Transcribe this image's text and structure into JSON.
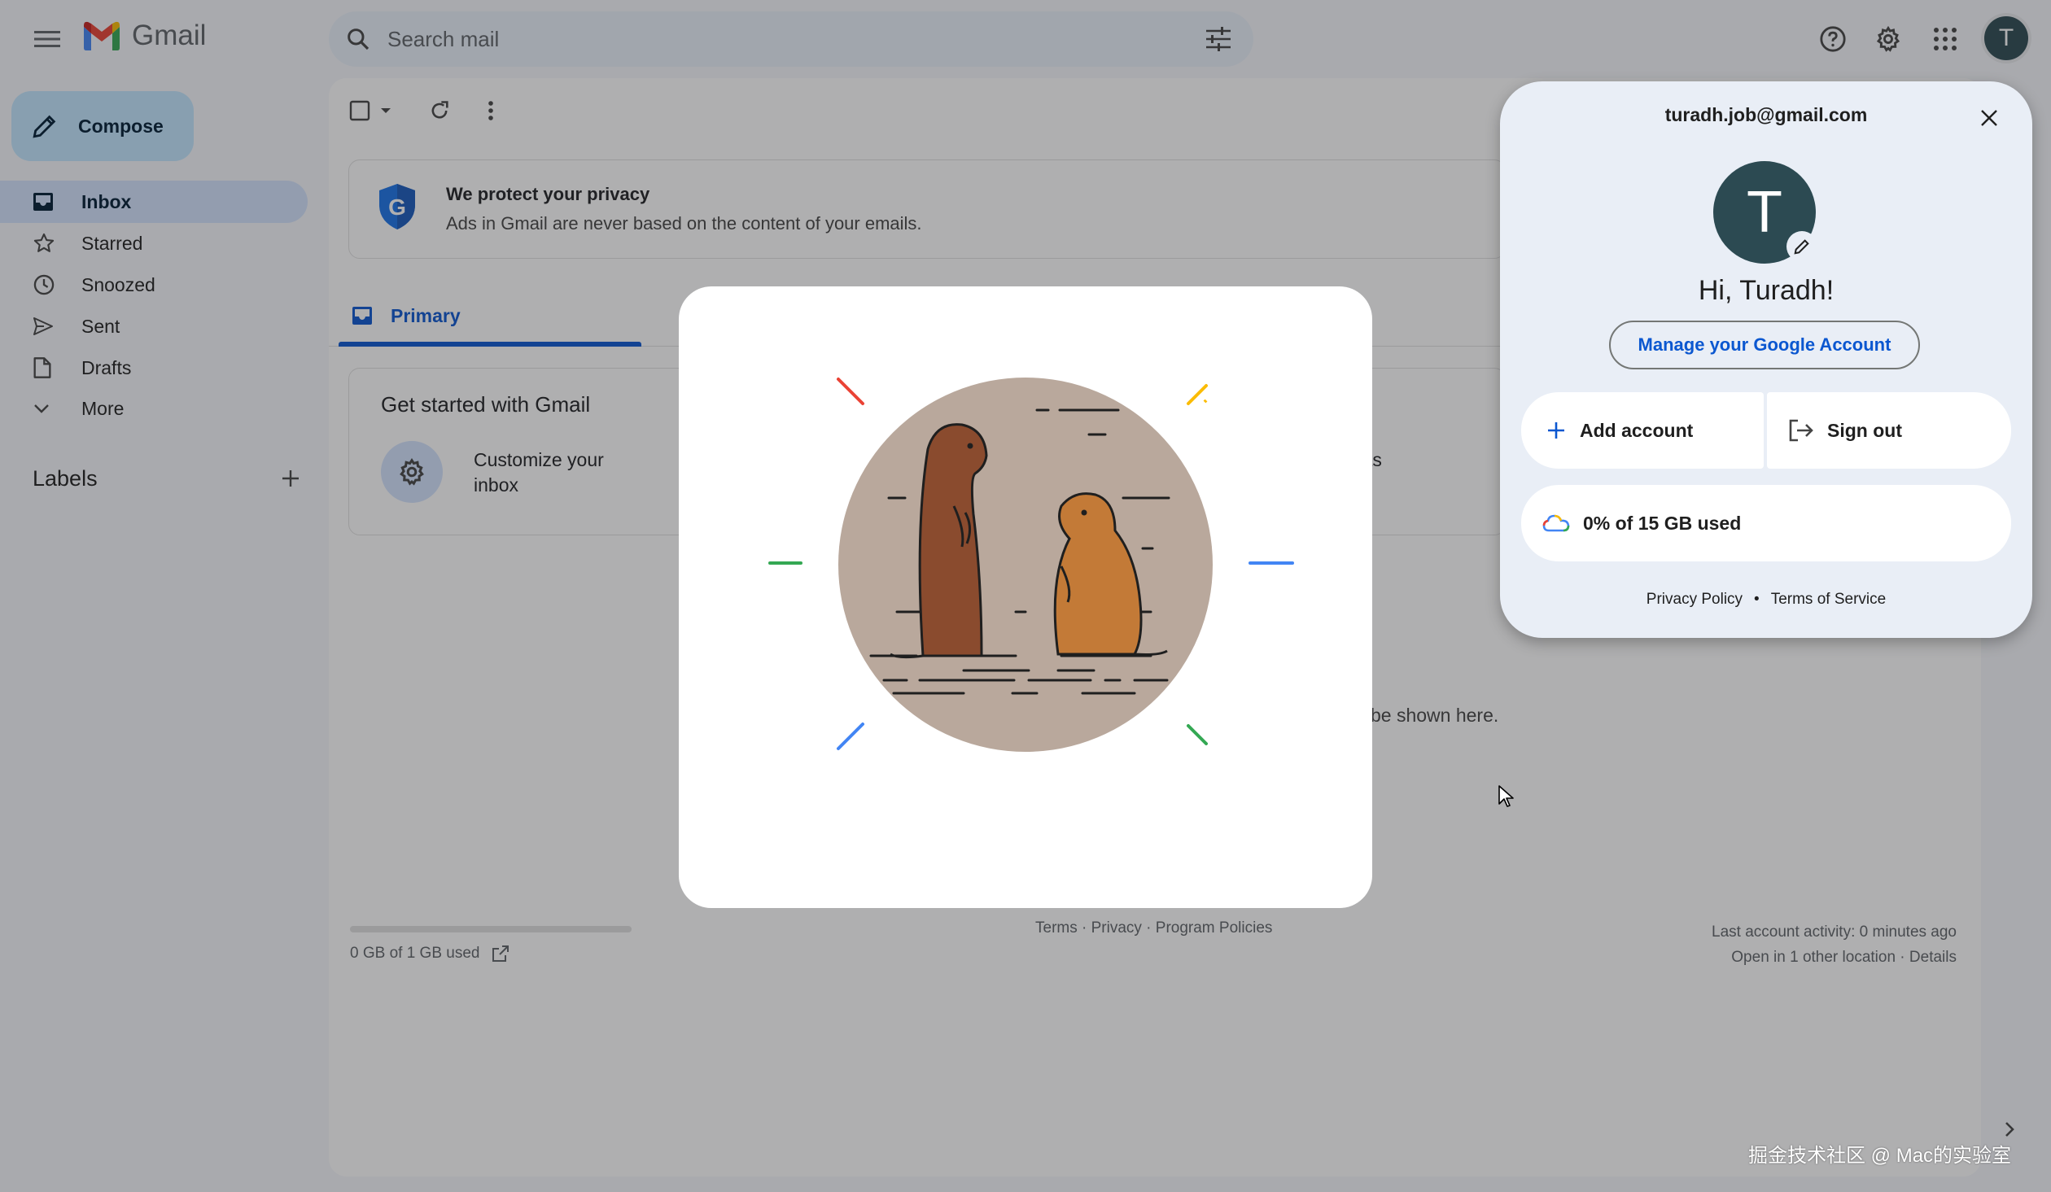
{
  "app": {
    "name": "Gmail"
  },
  "search": {
    "placeholder": "Search mail"
  },
  "header": {
    "avatar_letter": "T"
  },
  "sidebar": {
    "compose_label": "Compose",
    "items": [
      {
        "label": "Inbox",
        "icon": "inbox-icon",
        "active": true
      },
      {
        "label": "Starred",
        "icon": "star-icon"
      },
      {
        "label": "Snoozed",
        "icon": "clock-icon"
      },
      {
        "label": "Sent",
        "icon": "send-icon"
      },
      {
        "label": "Drafts",
        "icon": "draft-icon"
      },
      {
        "label": "More",
        "icon": "chevron-down-icon"
      }
    ],
    "labels_title": "Labels"
  },
  "main": {
    "privacy_title": "We protect your privacy",
    "privacy_sub": "Ads in Gmail are never based on the content of your emails.",
    "tabs": [
      {
        "label": "Primary"
      }
    ],
    "get_started": {
      "title": "Get started with Gmail",
      "item1": "Customize your inbox",
      "right_fragment": "ts"
    },
    "empty_msg": "be shown here.",
    "storage_text": "0 GB of 1 GB used",
    "footer_links": "Terms · Privacy · Program Policies",
    "last_activity": "Last account activity: 0 minutes ago",
    "other_location": "Open in 1 other location · Details"
  },
  "account": {
    "email": "turadh.job@gmail.com",
    "avatar_letter": "T",
    "greeting": "Hi, Turadh!",
    "manage_label": "Manage your Google Account",
    "add_account": "Add account",
    "sign_out": "Sign out",
    "storage": "0% of 15 GB used",
    "privacy_policy": "Privacy Policy",
    "terms": "Terms of Service"
  },
  "watermark": "掘金技术社区 @ Mac的实验室",
  "colors": {
    "accent": "#0b57d0",
    "compose_bg": "#c2e7ff",
    "active_nav": "#d3e3fd",
    "avatar_bg": "#2c4a52"
  }
}
